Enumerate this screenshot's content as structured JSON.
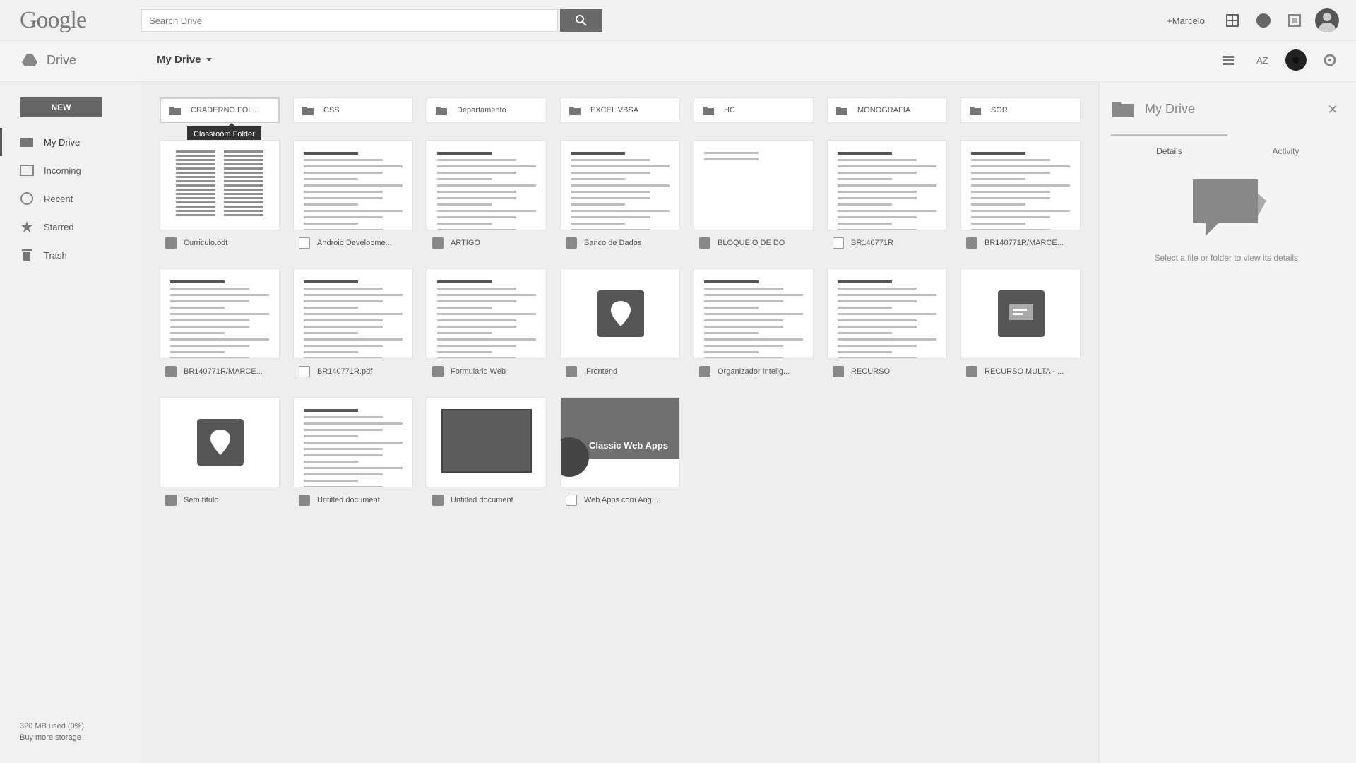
{
  "topbar": {
    "logo": "Google",
    "search_placeholder": "Search Drive",
    "user_name": "+Marcelo",
    "icons": [
      "apps-icon",
      "notifications-icon",
      "share-icon",
      "avatar"
    ]
  },
  "subbar": {
    "brand": "Drive",
    "breadcrumb": "My Drive",
    "icons": [
      "list-view-icon",
      "sort-icon",
      "info-icon",
      "settings-icon"
    ]
  },
  "leftnav": {
    "new_label": "NEW",
    "items": [
      {
        "label": "My Drive",
        "icon": "my-drive-icon",
        "active": true
      },
      {
        "label": "Incoming",
        "icon": "incoming-icon",
        "active": false
      },
      {
        "label": "Recent",
        "icon": "recent-icon",
        "active": false
      },
      {
        "label": "Starred",
        "icon": "starred-icon",
        "active": false
      },
      {
        "label": "Trash",
        "icon": "trash-icon",
        "active": false
      }
    ],
    "storage_text": "320 MB used (0%)",
    "storage_link": "Buy more storage"
  },
  "main": {
    "tooltip": "Classroom Folder",
    "folders": [
      {
        "label": "CRADERNO FOL..."
      },
      {
        "label": "CSS"
      },
      {
        "label": "Departamento"
      },
      {
        "label": "EXCEL VBSA"
      },
      {
        "label": "HC"
      },
      {
        "label": "MONOGRAFIA"
      },
      {
        "label": "SOR"
      }
    ],
    "files": [
      {
        "name": "Curriculo.odt",
        "type": "doc",
        "thumb": "twocol"
      },
      {
        "name": "Android Developme...",
        "type": "pdf",
        "thumb": "lines"
      },
      {
        "name": "ARTIGO",
        "type": "doc",
        "thumb": "lines"
      },
      {
        "name": "Banco de Dados",
        "type": "doc",
        "thumb": "lines"
      },
      {
        "name": "BLOQUEIO DE DO",
        "type": "doc",
        "thumb": "sparse"
      },
      {
        "name": "BR140771R",
        "type": "pdf",
        "thumb": "lines"
      },
      {
        "name": "BR140771R/MARCE...",
        "type": "ppt",
        "thumb": "lines"
      },
      {
        "name": "BR140771R/MARCE...",
        "type": "doc",
        "thumb": "lines"
      },
      {
        "name": "BR140771R.pdf",
        "type": "pdf",
        "thumb": "lines"
      },
      {
        "name": "Formulario Web",
        "type": "doc",
        "thumb": "lines"
      },
      {
        "name": "IFrontend",
        "type": "doc",
        "thumb": "bigicon"
      },
      {
        "name": "Organizador Intelig...",
        "type": "doc",
        "thumb": "lines"
      },
      {
        "name": "RECURSO",
        "type": "doc",
        "thumb": "lines"
      },
      {
        "name": "RECURSO MULTA - ...",
        "type": "doc",
        "thumb": "bigicon2"
      },
      {
        "name": "Sem título",
        "type": "doc",
        "thumb": "bigicon"
      },
      {
        "name": "Untitled document",
        "type": "doc",
        "thumb": "lines"
      },
      {
        "name": "Untitled document",
        "type": "doc",
        "thumb": "dark"
      },
      {
        "name": "Web Apps com Ang...",
        "type": "pdf",
        "thumb": "banner",
        "banner_title": "Classic Web Apps"
      }
    ]
  },
  "rightpanel": {
    "title": "My Drive",
    "tabs": [
      "Details",
      "Activity"
    ],
    "message": "Select a file or folder to view its details."
  },
  "colors": {
    "accent_dark": "#555555",
    "background": "#f1f1f1"
  }
}
